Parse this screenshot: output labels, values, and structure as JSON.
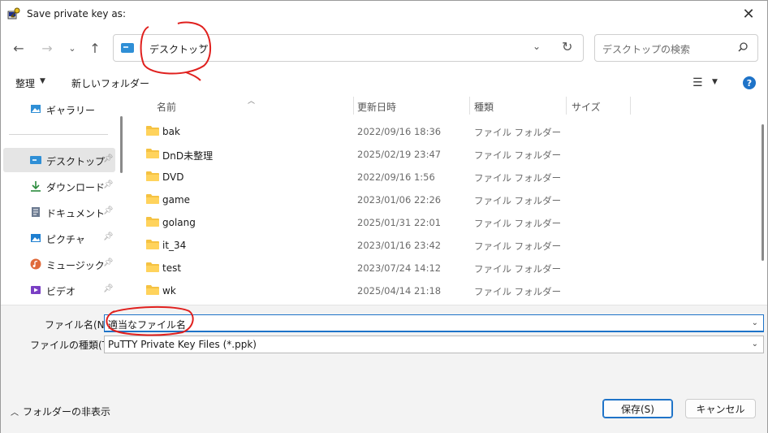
{
  "window": {
    "title": "Save private key as:"
  },
  "nav": {
    "address": "デスクトップ",
    "search_placeholder": "デスクトップの検索"
  },
  "toolbar": {
    "organize": "整理",
    "new_folder": "新しいフォルダー",
    "help": "?"
  },
  "sidebar": {
    "items": [
      {
        "label": "ギャラリー",
        "icon": "gallery-icon"
      },
      {
        "label": "デスクトップ",
        "icon": "desktop-icon",
        "selected": true
      },
      {
        "label": "ダウンロード",
        "icon": "download-icon"
      },
      {
        "label": "ドキュメント",
        "icon": "document-icon"
      },
      {
        "label": "ピクチャ",
        "icon": "pictures-icon"
      },
      {
        "label": "ミュージック",
        "icon": "music-icon"
      },
      {
        "label": "ビデオ",
        "icon": "video-icon"
      }
    ]
  },
  "columns": {
    "name": "名前",
    "date": "更新日時",
    "type": "種類",
    "size": "サイズ"
  },
  "files": [
    {
      "name": "bak",
      "date": "2022/09/16 18:36",
      "type": "ファイル フォルダー"
    },
    {
      "name": "DnD未整理",
      "date": "2025/02/19 23:47",
      "type": "ファイル フォルダー"
    },
    {
      "name": "DVD",
      "date": "2022/09/16 1:56",
      "type": "ファイル フォルダー"
    },
    {
      "name": "game",
      "date": "2023/01/06 22:26",
      "type": "ファイル フォルダー"
    },
    {
      "name": "golang",
      "date": "2025/01/31 22:01",
      "type": "ファイル フォルダー"
    },
    {
      "name": "it_34",
      "date": "2023/01/16 23:42",
      "type": "ファイル フォルダー"
    },
    {
      "name": "test",
      "date": "2023/07/24 14:12",
      "type": "ファイル フォルダー"
    },
    {
      "name": "wk",
      "date": "2025/04/14 21:18",
      "type": "ファイル フォルダー"
    }
  ],
  "form": {
    "filename_label": "ファイル名(N):",
    "filename_value": "適当なファイル名",
    "filetype_label": "ファイルの種類(T):",
    "filetype_value": "PuTTY Private Key Files (*.ppk)"
  },
  "footer": {
    "hide_folders": "フォルダーの非表示",
    "save": "保存(S)",
    "cancel": "キャンセル"
  },
  "colors": {
    "accent": "#1e73c8",
    "folder": "#f5c242",
    "annotation": "#e0201e"
  }
}
